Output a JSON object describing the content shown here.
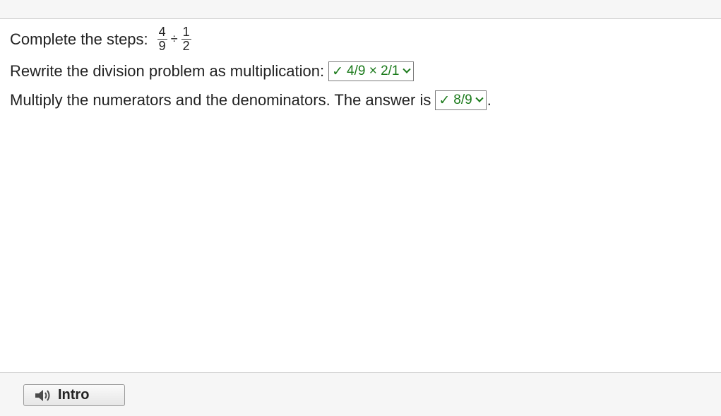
{
  "problem": {
    "prompt": "Complete the steps:",
    "fraction1": {
      "numerator": "4",
      "denominator": "9"
    },
    "operator": "÷",
    "fraction2": {
      "numerator": "1",
      "denominator": "2"
    }
  },
  "step1": {
    "text": "Rewrite the division problem as multiplication:",
    "selected_value": "4/9 × 2/1",
    "status": "correct",
    "check_mark": "✓"
  },
  "step2": {
    "text": "Multiply the numerators and the denominators. The answer is",
    "selected_value": "8/9",
    "status": "correct",
    "check_mark": "✓",
    "trailing": "."
  },
  "footer": {
    "intro_label": "Intro",
    "intro_icon": "speaker-icon"
  },
  "colors": {
    "correct_green": "#1b7a1b",
    "top_accent": "#f0a060"
  }
}
